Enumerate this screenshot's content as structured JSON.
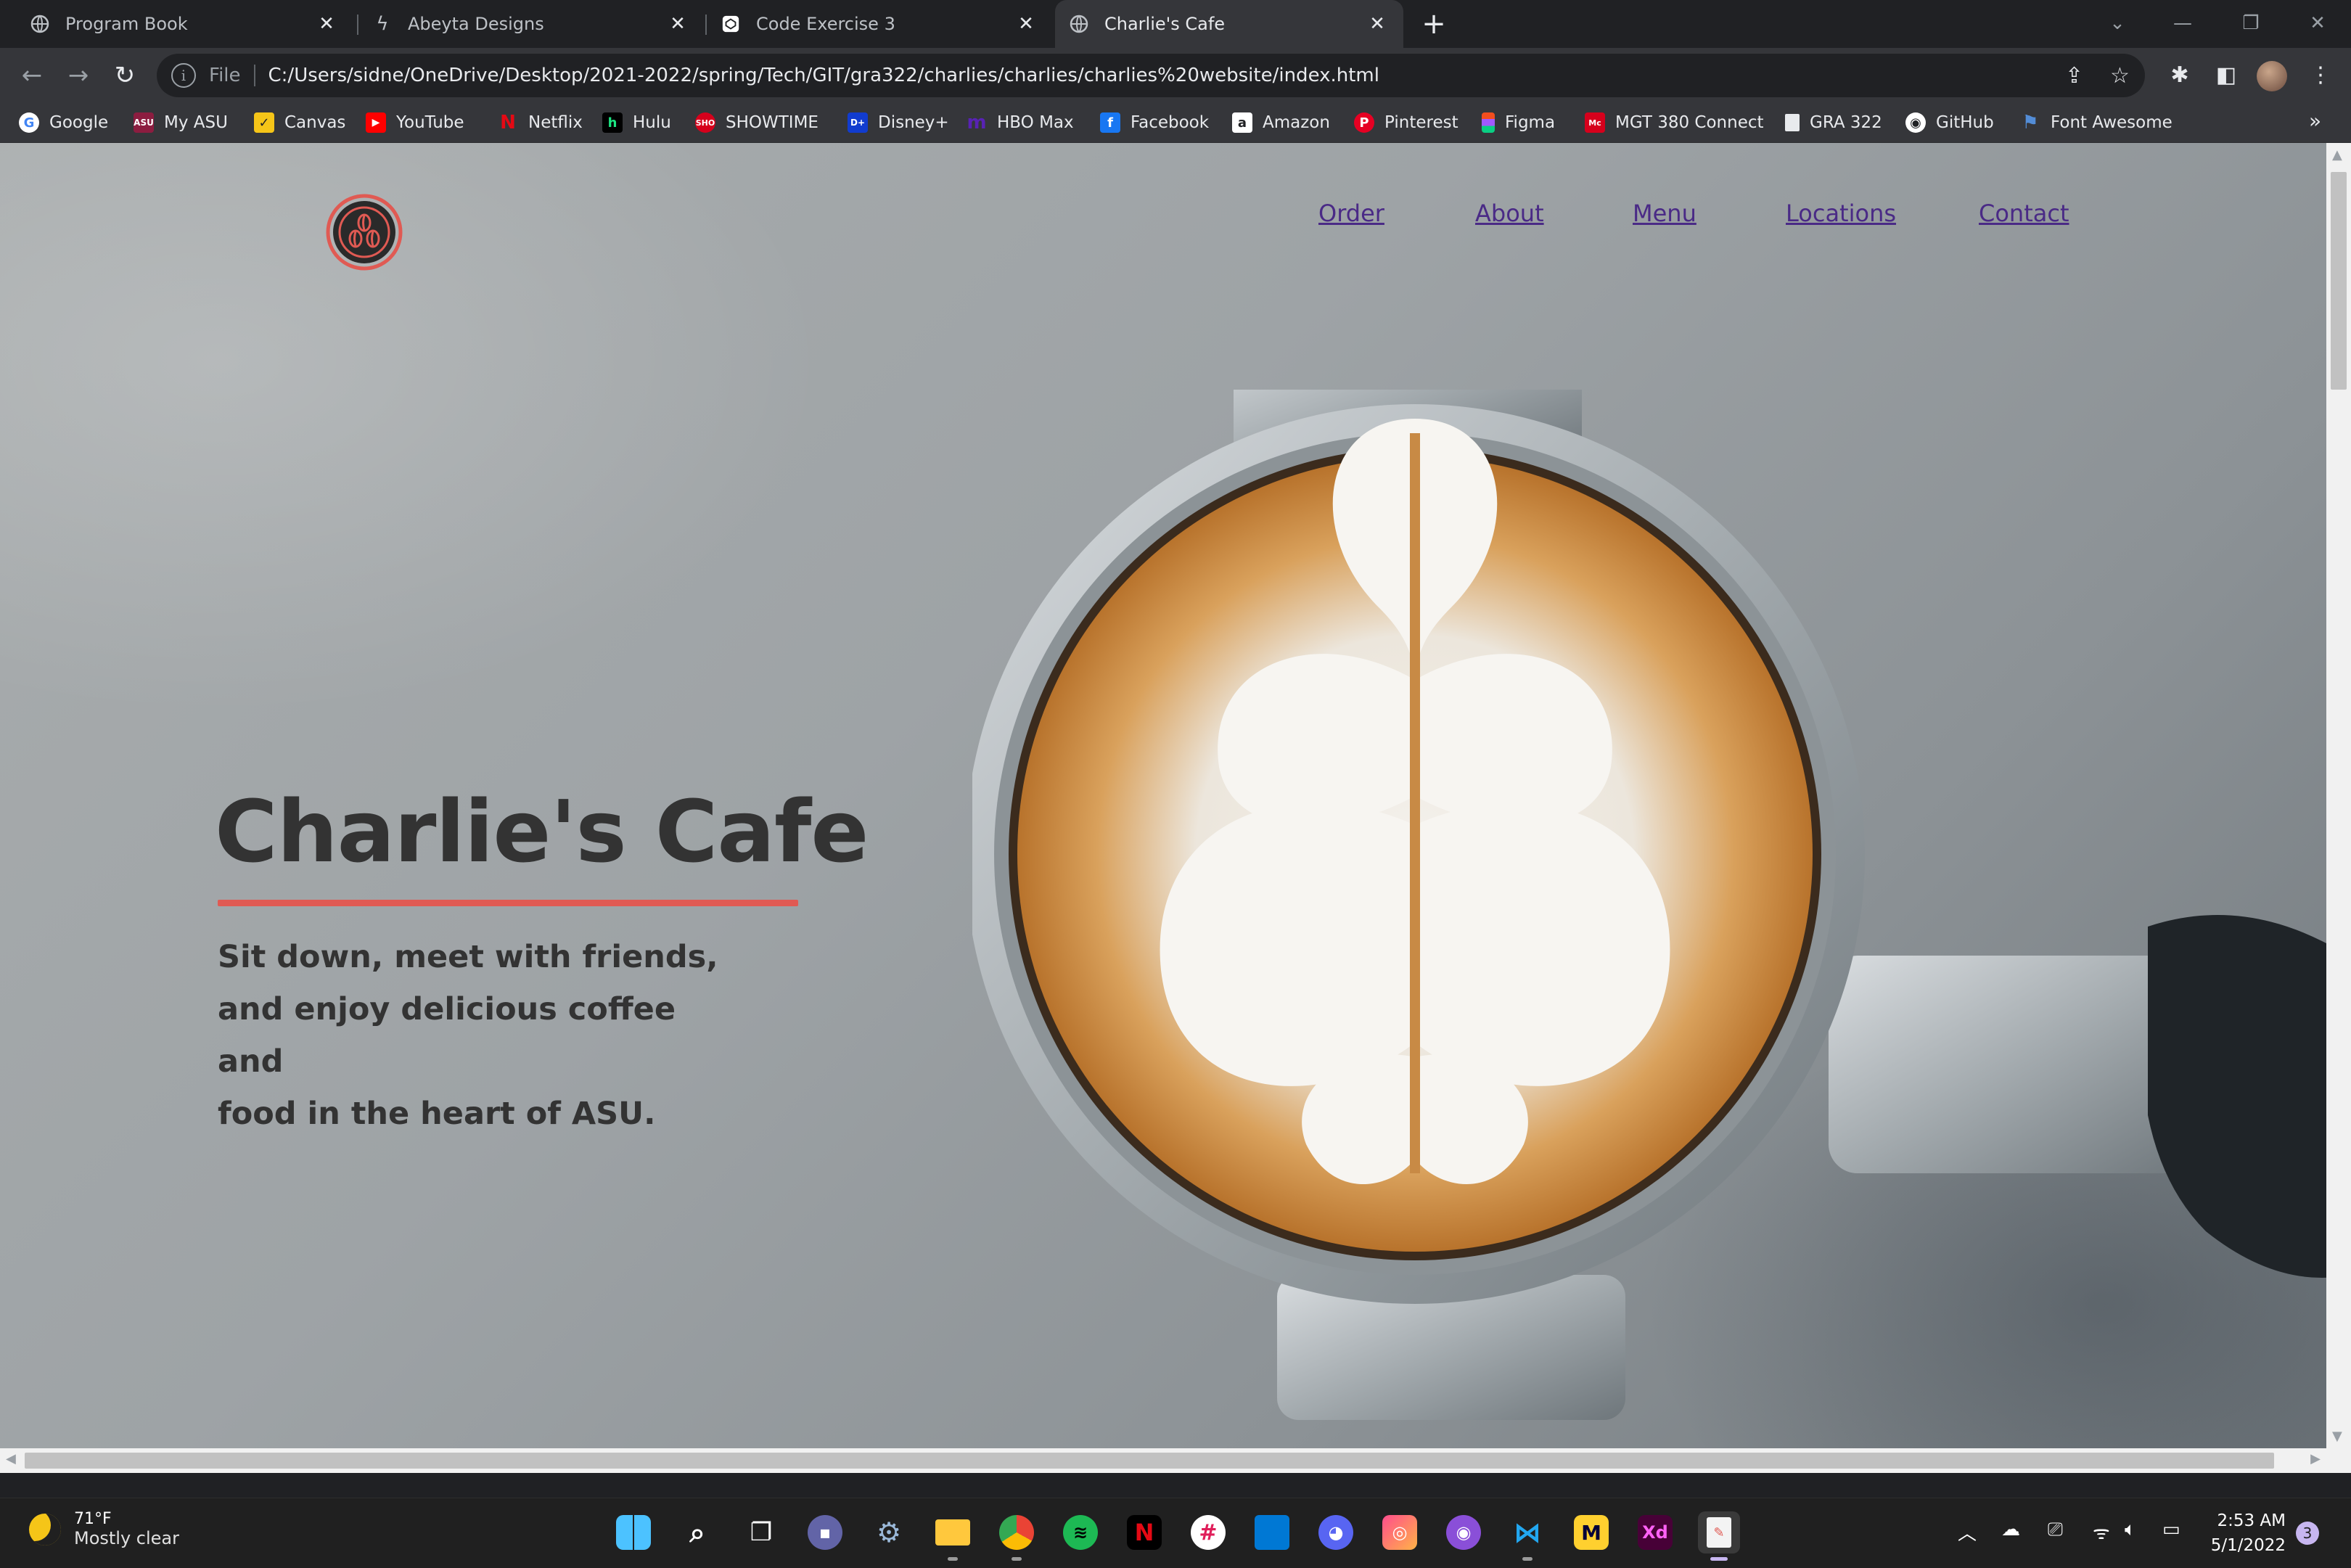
{
  "browser": {
    "tabs": [
      {
        "label": "Program Book",
        "icon": "globe-icon"
      },
      {
        "label": "Abeyta Designs",
        "icon": "bolt-icon"
      },
      {
        "label": "Code Exercise 3",
        "icon": "codepen-icon"
      },
      {
        "label": "Charlie's Cafe",
        "icon": "globe-icon",
        "active": true
      }
    ],
    "address": {
      "scheme": "File",
      "url": "C:/Users/sidne/OneDrive/Desktop/2021-2022/spring/Tech/GIT/gra322/charlies/charlies/charlies%20website/index.html"
    },
    "bookmarks": [
      {
        "label": "Google",
        "icon": "google-icon",
        "color": "#ffffff"
      },
      {
        "label": "My ASU",
        "icon": "asu-icon",
        "color": "#8c1d40"
      },
      {
        "label": "Canvas",
        "icon": "canvas-icon",
        "color": "#f5c518"
      },
      {
        "label": "YouTube",
        "icon": "youtube-icon",
        "color": "#ff0000"
      },
      {
        "label": "Netflix",
        "icon": "netflix-icon",
        "color": "#e50914"
      },
      {
        "label": "Hulu",
        "icon": "hulu-icon",
        "color": "#1ce783"
      },
      {
        "label": "SHOWTIME",
        "icon": "showtime-icon",
        "color": "#d6001c"
      },
      {
        "label": "Disney+",
        "icon": "disney-icon",
        "color": "#113ccf"
      },
      {
        "label": "HBO Max",
        "icon": "hbomax-icon",
        "color": "#5822b4"
      },
      {
        "label": "Facebook",
        "icon": "facebook-icon",
        "color": "#1877f2"
      },
      {
        "label": "Amazon",
        "icon": "amazon-icon",
        "color": "#ffffff"
      },
      {
        "label": "Pinterest",
        "icon": "pinterest-icon",
        "color": "#e60023"
      },
      {
        "label": "Figma",
        "icon": "figma-icon",
        "color": "#a259ff"
      },
      {
        "label": "MGT 380 Connect",
        "icon": "connect-icon",
        "color": "#d6001c"
      },
      {
        "label": "GRA 322",
        "icon": "page-icon",
        "color": "#e8eaed"
      },
      {
        "label": "GitHub",
        "icon": "github-icon",
        "color": "#ffffff"
      },
      {
        "label": "Font Awesome",
        "icon": "flag-icon",
        "color": "#538dd7"
      }
    ]
  },
  "site": {
    "nav": [
      "Order",
      "About",
      "Menu",
      "Locations",
      "Contact"
    ],
    "hero": {
      "title": "Charlie's Cafe",
      "subtitle_lines": [
        "Sit down, meet with friends,",
        "and enjoy delicious coffee and",
        "food in the heart of ASU."
      ]
    },
    "colors": {
      "accent": "#e05a53",
      "link": "#4a2a86",
      "text": "#333333"
    }
  },
  "taskbar": {
    "weather": {
      "temp": "71°F",
      "condition": "Mostly clear"
    },
    "apps": [
      "windows-start-icon",
      "search-icon",
      "task-view-icon",
      "chat-icon",
      "settings-icon",
      "file-explorer-icon",
      "chrome-icon",
      "spotify-icon",
      "netflix-icon",
      "slack-icon",
      "store-icon",
      "discord-icon",
      "photos-icon",
      "github-desktop-icon",
      "vscode-icon",
      "miro-icon",
      "xd-icon",
      "editor-icon"
    ],
    "clock": {
      "time": "2:53 AM",
      "date": "5/1/2022"
    },
    "notifications": "3"
  }
}
